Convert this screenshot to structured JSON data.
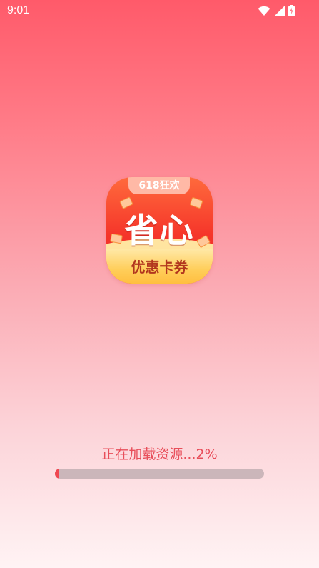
{
  "status_bar": {
    "time": "9:01",
    "icons": [
      "wifi-icon",
      "cell-signal-icon",
      "battery-charging-icon"
    ]
  },
  "app_icon": {
    "tag": "618狂欢",
    "main": "省心",
    "bottom": "优惠卡券"
  },
  "loading": {
    "text": "正在加载资源...2%",
    "progress_percent": 2
  },
  "colors": {
    "accent": "#f04650",
    "text": "#e84e5a",
    "track": "#cbb6ba"
  }
}
